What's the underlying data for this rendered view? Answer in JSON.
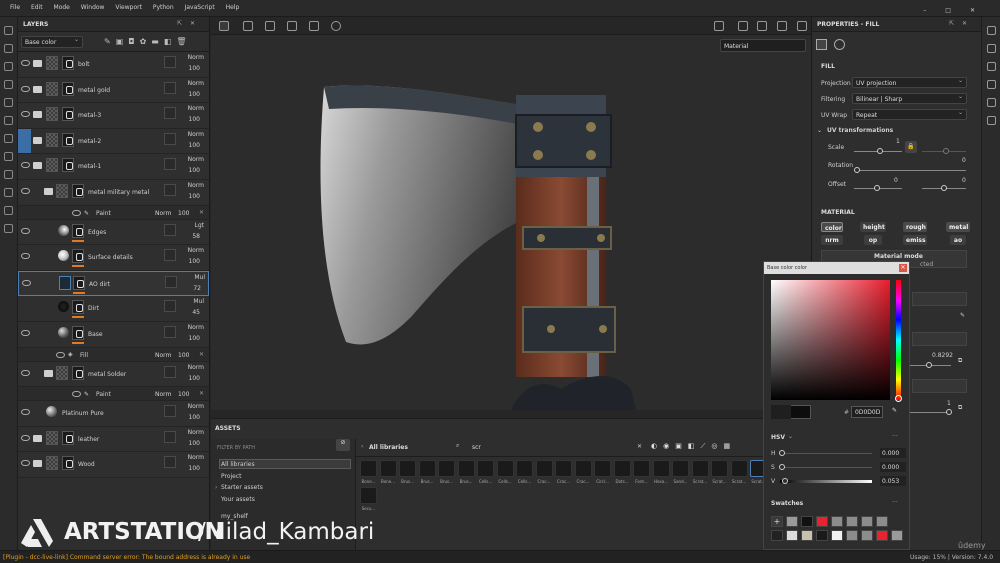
{
  "menubar": {
    "items": [
      "File",
      "Edit",
      "Mode",
      "Window",
      "Viewport",
      "Python",
      "JavaScript",
      "Help"
    ]
  },
  "layers": {
    "title": "LAYERS",
    "channel": "Base color",
    "rows": [
      {
        "name": "bolt",
        "blend": "Norm",
        "opacity": "100"
      },
      {
        "name": "metal gold",
        "blend": "Norm",
        "opacity": "100"
      },
      {
        "name": "metal-3",
        "blend": "Norm",
        "opacity": "100"
      },
      {
        "name": "metal-2",
        "blend": "Norm",
        "opacity": "100"
      },
      {
        "name": "metal-1",
        "blend": "Norm",
        "opacity": "100"
      },
      {
        "name": "metal military metal",
        "blend": "Norm",
        "opacity": "100"
      },
      {
        "name": "Paint",
        "blend": "Norm",
        "opacity": "100"
      },
      {
        "name": "Edges",
        "blend": "Lgt",
        "opacity": "58"
      },
      {
        "name": "Surface details",
        "blend": "Norm",
        "opacity": "100"
      },
      {
        "name": "AO dirt",
        "blend": "Mul",
        "opacity": "72"
      },
      {
        "name": "Dirt",
        "blend": "Mul",
        "opacity": "45"
      },
      {
        "name": "Base",
        "blend": "Norm",
        "opacity": "100"
      },
      {
        "name": "Fill",
        "blend": "Norm",
        "opacity": "100"
      },
      {
        "name": "metal Solder",
        "blend": "Norm",
        "opacity": "100"
      },
      {
        "name": "Paint",
        "blend": "Norm",
        "opacity": "100"
      },
      {
        "name": "Platinum Pure",
        "blend": "Norm",
        "opacity": "100"
      },
      {
        "name": "leather",
        "blend": "Norm",
        "opacity": "100"
      },
      {
        "name": "Wood",
        "blend": "Norm",
        "opacity": "100"
      }
    ]
  },
  "viewport": {
    "material_select": "Material"
  },
  "assets": {
    "title": "ASSETS",
    "filter_label": "FILTER BY PATH",
    "tree": [
      "All libraries",
      "Project",
      "Starter assets",
      "Your assets",
      "my_shelf"
    ],
    "breadcrumb": "All libraries",
    "search": "scr",
    "tiles": [
      "Bone...",
      "Bone...",
      "Brus...",
      "Brus...",
      "Brus...",
      "Brus...",
      "Cells...",
      "Cells...",
      "Cells...",
      "Crac...",
      "Crac...",
      "Crac...",
      "Circl...",
      "Dots...",
      "Font...",
      "Hexa...",
      "Sand...",
      "Scrat...",
      "Scrat...",
      "Scrat...",
      "Scrat...",
      "Secu..."
    ]
  },
  "properties": {
    "title": "PROPERTIES - FILL",
    "section_fill": "FILL",
    "projection_label": "Projection",
    "projection": "UV projection",
    "filtering_label": "Filtering",
    "filtering": "Bilinear | Sharp",
    "uvwrap_label": "UV Wrap",
    "uvwrap": "Repeat",
    "uvtrans": "UV transformations",
    "scale_label": "Scale",
    "scale_val": "1",
    "rotation_label": "Rotation",
    "rotation_val": "0",
    "offset_label": "Offset",
    "offset_val1": "0",
    "offset_val2": "0",
    "section_material": "MATERIAL",
    "channels": [
      "color",
      "height",
      "rough",
      "metal",
      "nrm",
      "op",
      "emiss",
      "ao"
    ],
    "material_mode": "Material mode",
    "material_mode_value": "cted",
    "value_a": "0.8292",
    "value_b": "1"
  },
  "color_picker": {
    "title": "Base color color",
    "hex": "0D0D0D",
    "mode": "HSV",
    "h_label": "H",
    "h": "0.000",
    "s_label": "S",
    "s": "0.000",
    "v_label": "V",
    "v": "0.053",
    "swatches_label": "Swatches",
    "swatches": [
      "#9a9a9a",
      "#111111",
      "#e8232f",
      "#8c8c8c",
      "#8c8c8c",
      "#8c8c8c",
      "#8c8c8c",
      "#222222",
      "#dcdcdc",
      "#c9c0b0",
      "#1a1a1a",
      "#f2f2f2",
      "#8c8c8c",
      "#8c8c8c",
      "#e8232f",
      "#9a9a9a"
    ]
  },
  "footer": {
    "status": "[Plugin - dcc-live-link] Command server error: The bound address is already in use",
    "usage": "Usage: 15% | Version: 7.4.0"
  },
  "watermark": {
    "brand": "ARTSTATION",
    "text": "/Milad_Kambari",
    "udemy": "ûdemy"
  },
  "colors": {
    "accent": "#e07a22",
    "selection": "#3a6ea5",
    "picker_red": "#e81d2d"
  }
}
